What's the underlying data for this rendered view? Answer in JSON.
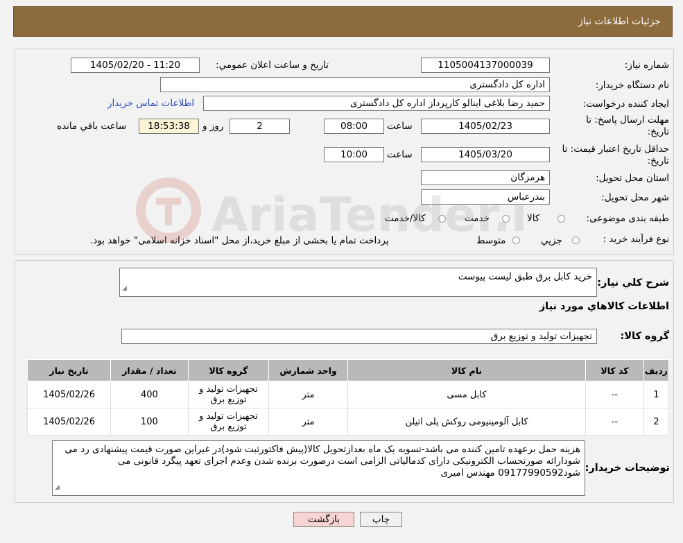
{
  "header": {
    "title": "جزئیات اطلاعات نیاز"
  },
  "info": {
    "need_number_label": "شماره نیاز:",
    "need_number": "1105004137000039",
    "announce_label": "تاریخ و ساعت اعلان عمومي:",
    "announce_value": "1405/02/20 - 11:20",
    "buyer_org_label": "نام دستگاه خريدار:",
    "buyer_org": "اداره کل دادگستری",
    "creator_label": "ايجاد کننده درخواست:",
    "creator": "حمید رضا  بلاغی اینالو کارپرداز اداره کل دادگستری",
    "contact_link": "اطلاعات تماس خريدار",
    "deadline_label": "مهلت ارسال پاسخ: تا تاريخ:",
    "deadline_date": "1405/02/23",
    "time_label": "ساعت",
    "deadline_time": "08:00",
    "days_value": "2",
    "days_label": "روز و",
    "remaining_time": "18:53:38",
    "remaining_label": "ساعت باقي مانده",
    "validity_label": "حداقل تاريخ اعتبار قيمت: تا تاريخ:",
    "validity_date": "1405/03/20",
    "validity_time": "10:00",
    "province_label": "استان محل تحويل:",
    "province": "هرمزگان",
    "city_label": "شهر محل تحويل:",
    "city": "بندرعباس",
    "category_label": "طبقه بندی موضوعی:",
    "category_options": [
      "کالا",
      "خدمت",
      "کالا/خدمت"
    ],
    "process_label": "نوع فرآيند خريد :",
    "process_options": [
      "جزيي",
      "متوسط"
    ],
    "process_note": "پرداخت تمام يا بخشی از مبلغ خريد،از محل \"اسناد خزانه اسلامی\" خواهد بود."
  },
  "description": {
    "summary_label": "شرح کلي نياز:",
    "summary": "خرید کابل برق طبق لیست پیوست",
    "goods_info_title": "اطلاعات کالاهاي مورد نياز",
    "goods_group_label": "گروه کالا:",
    "goods_group": "تجهیزات تولید و توزیع برق"
  },
  "table": {
    "headers": [
      "رديف",
      "کد کالا",
      "نام کالا",
      "واحد شمارش",
      "گروه کالا",
      "تعداد / مقدار",
      "تاريخ نياز"
    ],
    "rows": [
      [
        "1",
        "--",
        "کابل مسی",
        "متر",
        "تجهیزات تولید و توزیع برق",
        "400",
        "1405/02/26"
      ],
      [
        "2",
        "--",
        "کابل آلومینیومی روکش پلی اتیلن",
        "متر",
        "تجهیزات تولید و توزیع برق",
        "100",
        "1405/02/26"
      ]
    ]
  },
  "buyer_notes": {
    "label": "توضيحات خريدار:",
    "text": "هزینه حمل برعهده تامین کننده می باشد-تسویه یک ماه بعدازتحویل کالا(پیش فاکتورثبت شود)در غیراین صورت قیمت پیشنهادی رد می شودارائه صورتحساب الکترونیکی دارای کدمالیاتی الزامی است درصورت برنده شدن وعدم اجرای تعهد پیگرد قانونی می شود09177990592 مهندس امیری"
  },
  "buttons": {
    "print": "چاپ",
    "back": "بازگشت"
  },
  "watermark": {
    "text": "AriaTender.neT"
  },
  "colors": {
    "header": "#8c6c3d",
    "link": "#2a47b8",
    "table_header": "#b9b9b9",
    "back_button": "#f7d4d4"
  }
}
